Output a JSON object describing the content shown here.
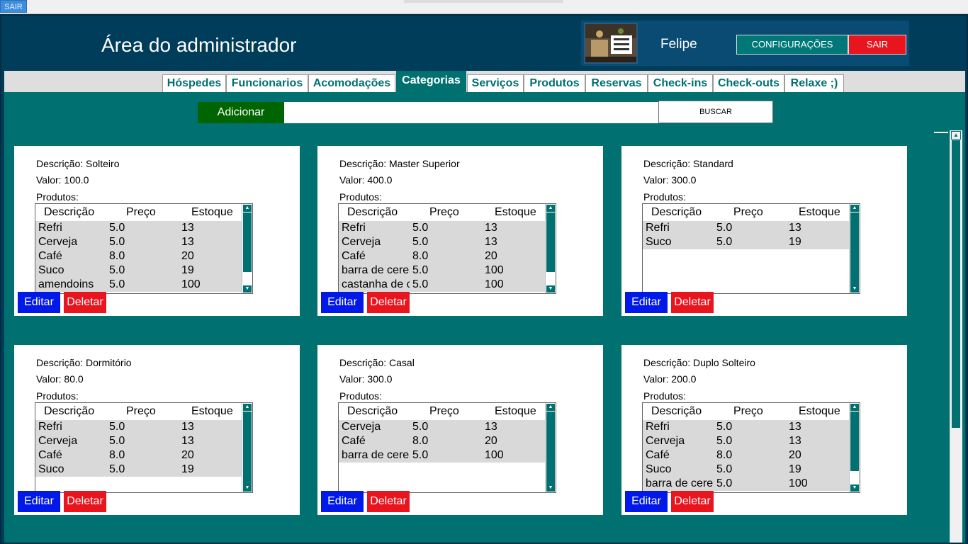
{
  "top_strip": {
    "exit_label": "SAIR"
  },
  "header": {
    "title": "Área do administrador",
    "user_name": "Felipe",
    "config_label": "CONFIGURAÇÕES",
    "logout_label": "SAIR"
  },
  "tabs": [
    {
      "label": "Hóspedes"
    },
    {
      "label": "Funcionarios"
    },
    {
      "label": "Acomodações"
    },
    {
      "label": "Categorias",
      "active": true
    },
    {
      "label": "Serviços"
    },
    {
      "label": "Produtos"
    },
    {
      "label": "Reservas"
    },
    {
      "label": "Check-ins"
    },
    {
      "label": "Check-outs"
    },
    {
      "label": "Relaxe ;)"
    }
  ],
  "search": {
    "add_label": "Adicionar",
    "input_value": "",
    "search_label": "BUSCAR"
  },
  "table_headers": {
    "desc": "Descrição",
    "price": "Preço",
    "stock": "Estoque"
  },
  "actions": {
    "edit": "Editar",
    "delete": "Deletar"
  },
  "cards": [
    {
      "desc": "Descrição: Solteiro",
      "val": "Valor: 100.0",
      "prod_label": "Produtos:",
      "products": [
        [
          "Refri",
          "5.0",
          "13"
        ],
        [
          "Cerveja",
          "5.0",
          "13"
        ],
        [
          "Café",
          "8.0",
          "20"
        ],
        [
          "Suco",
          "5.0",
          "19"
        ],
        [
          "amendoins",
          "5.0",
          "100"
        ]
      ]
    },
    {
      "desc": "Descrição: Master Superior",
      "val": "Valor: 400.0",
      "prod_label": "Produtos:",
      "products": [
        [
          "Refri",
          "5.0",
          "13"
        ],
        [
          "Cerveja",
          "5.0",
          "13"
        ],
        [
          "Café",
          "8.0",
          "20"
        ],
        [
          "barra de cereal",
          "5.0",
          "100"
        ],
        [
          "castanha de caju",
          "5.0",
          "100"
        ]
      ]
    },
    {
      "desc": "Descrição: Standard",
      "val": "Valor: 300.0",
      "prod_label": "Produtos:",
      "products": [
        [
          "Refri",
          "5.0",
          "13"
        ],
        [
          "Suco",
          "5.0",
          "19"
        ]
      ]
    },
    {
      "desc": "Descrição: Dormitório",
      "val": "Valor: 80.0",
      "prod_label": "Produtos:",
      "products": [
        [
          "Refri",
          "5.0",
          "13"
        ],
        [
          "Cerveja",
          "5.0",
          "13"
        ],
        [
          "Café",
          "8.0",
          "20"
        ],
        [
          "Suco",
          "5.0",
          "19"
        ]
      ]
    },
    {
      "desc": "Descrição: Casal",
      "val": "Valor: 300.0",
      "prod_label": "Produtos:",
      "products": [
        [
          "Cerveja",
          "5.0",
          "13"
        ],
        [
          "Café",
          "8.0",
          "20"
        ],
        [
          "barra de cereal",
          "5.0",
          "100"
        ]
      ]
    },
    {
      "desc": "Descrição: Duplo Solteiro",
      "val": "Valor: 200.0",
      "prod_label": "Produtos:",
      "products": [
        [
          "Refri",
          "5.0",
          "13"
        ],
        [
          "Cerveja",
          "5.0",
          "13"
        ],
        [
          "Café",
          "8.0",
          "20"
        ],
        [
          "Suco",
          "5.0",
          "19"
        ],
        [
          "barra de cereal",
          "5.0",
          "100"
        ]
      ]
    }
  ]
}
